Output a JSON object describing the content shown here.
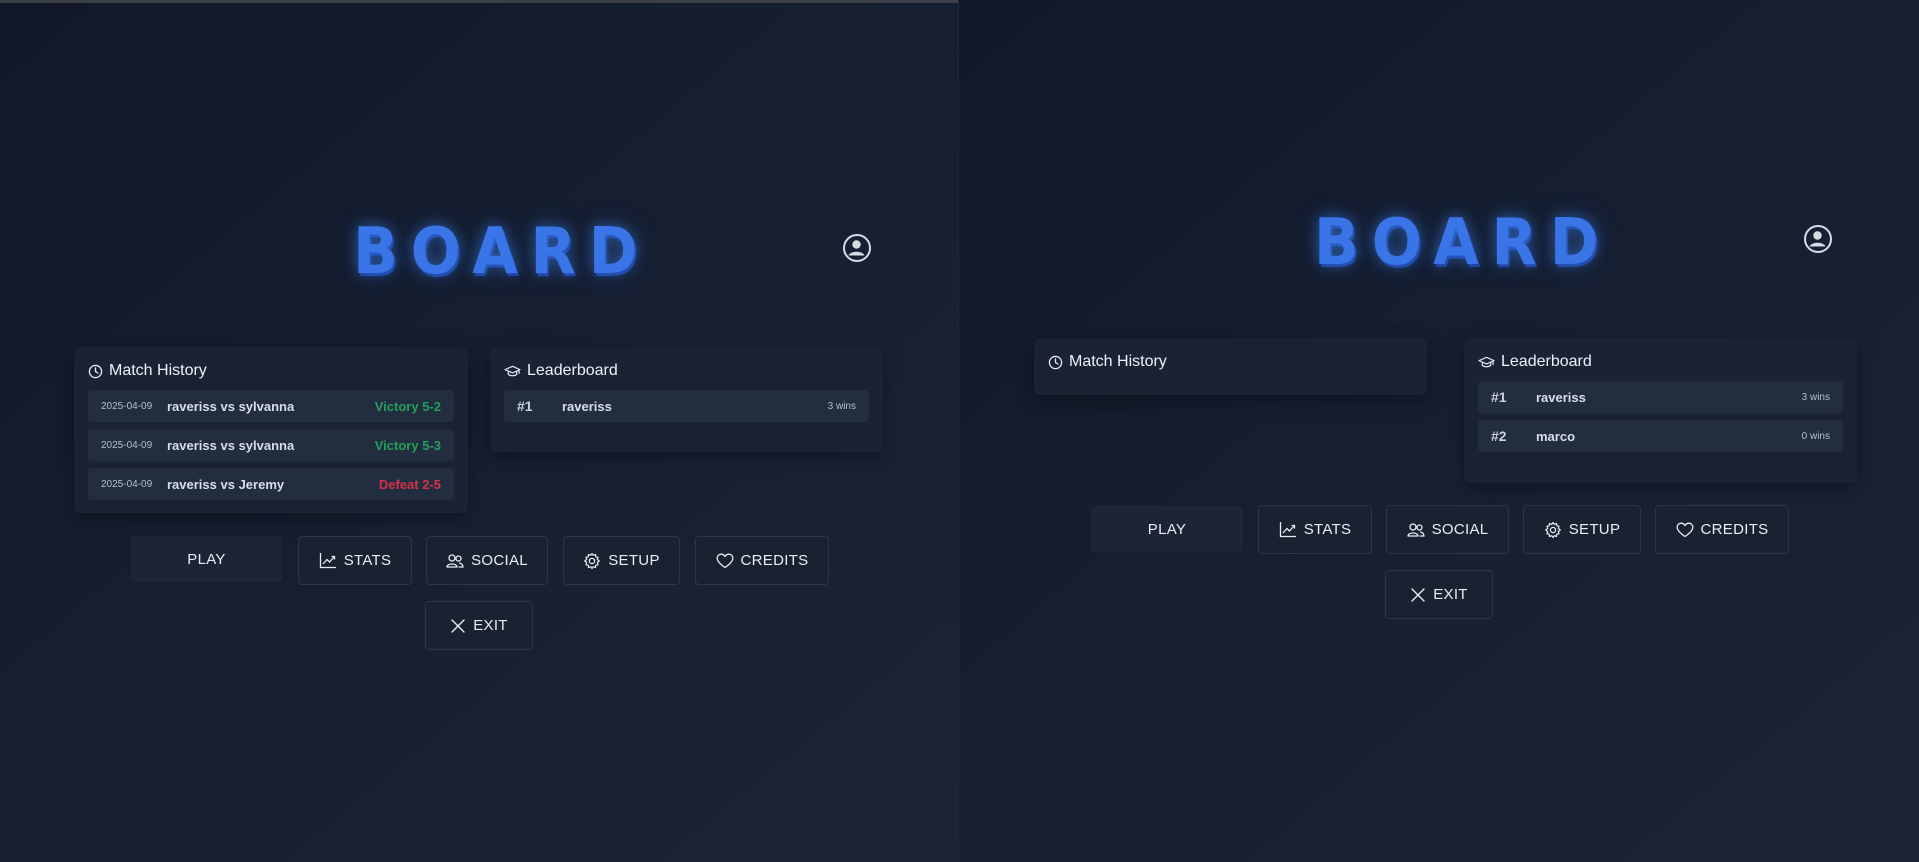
{
  "colors": {
    "accent": "#3a75e8",
    "victory": "#22a05a",
    "defeat": "#d3324a"
  },
  "left": {
    "logo": "BOARD",
    "match_history": {
      "title": "Match History",
      "rows": [
        {
          "date": "2025-04-09",
          "match": "raveriss vs sylvanna",
          "result": "Victory 5-2",
          "outcome": "victory"
        },
        {
          "date": "2025-04-09",
          "match": "raveriss vs sylvanna",
          "result": "Victory 5-3",
          "outcome": "victory"
        },
        {
          "date": "2025-04-09",
          "match": "raveriss vs Jeremy",
          "result": "Defeat 2-5",
          "outcome": "defeat"
        }
      ]
    },
    "leaderboard": {
      "title": "Leaderboard",
      "rows": [
        {
          "rank": "#1",
          "player": "raveriss",
          "wins": "3 wins"
        }
      ]
    },
    "buttons": {
      "play": "PLAY",
      "stats": "STATS",
      "social": "SOCIAL",
      "setup": "SETUP",
      "credits": "CREDITS",
      "exit": "EXIT"
    }
  },
  "right": {
    "logo": "BOARD",
    "match_history": {
      "title": "Match History",
      "rows": []
    },
    "leaderboard": {
      "title": "Leaderboard",
      "rows": [
        {
          "rank": "#1",
          "player": "raveriss",
          "wins": "3 wins"
        },
        {
          "rank": "#2",
          "player": "marco",
          "wins": "0 wins"
        }
      ]
    },
    "buttons": {
      "play": "PLAY",
      "stats": "STATS",
      "social": "SOCIAL",
      "setup": "SETUP",
      "credits": "CREDITS",
      "exit": "EXIT"
    }
  },
  "icons": {
    "profile": "user-circle-icon",
    "match_history": "clock-icon",
    "leaderboard": "graduation-cap-icon",
    "stats": "trending-up-icon",
    "social": "users-icon",
    "setup": "gear-icon",
    "credits": "heart-icon",
    "exit": "close-icon"
  }
}
